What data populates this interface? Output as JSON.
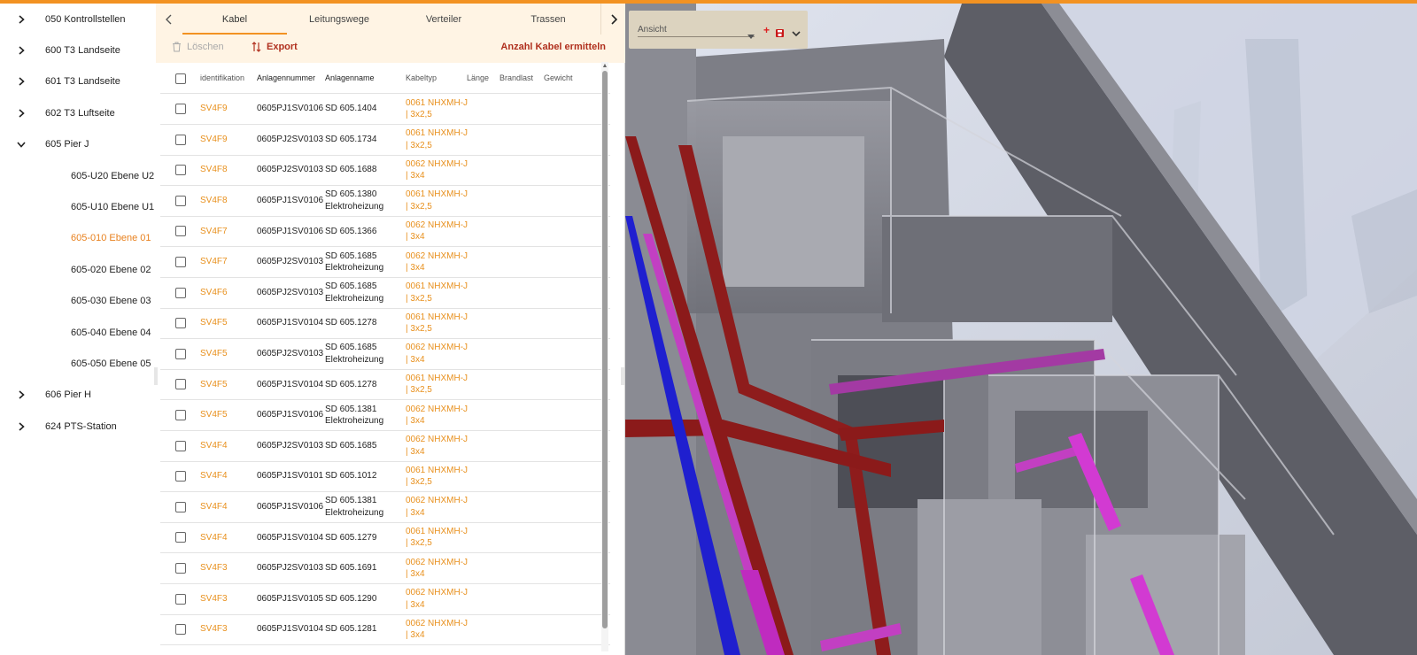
{
  "tree": [
    {
      "label": "050 Kontrollstellen",
      "level": 0,
      "expanded": false
    },
    {
      "label": "600 T3 Landseite",
      "level": 0,
      "expanded": false
    },
    {
      "label": "601 T3 Landseite",
      "level": 0,
      "expanded": false
    },
    {
      "label": "602 T3 Luftseite",
      "level": 0,
      "expanded": false
    },
    {
      "label": "605 Pier J",
      "level": 0,
      "expanded": true
    },
    {
      "label": "605-U20 Ebene U2",
      "level": 1
    },
    {
      "label": "605-U10 Ebene U1",
      "level": 1
    },
    {
      "label": "605-010 Ebene 01",
      "level": 1,
      "active": true
    },
    {
      "label": "605-020 Ebene 02",
      "level": 1
    },
    {
      "label": "605-030 Ebene 03",
      "level": 1
    },
    {
      "label": "605-040 Ebene 04",
      "level": 1
    },
    {
      "label": "605-050 Ebene 05",
      "level": 1
    },
    {
      "label": "606 Pier H",
      "level": 0,
      "expanded": false
    },
    {
      "label": "624 PTS-Station",
      "level": 0,
      "expanded": false
    }
  ],
  "tabs": [
    "Kabel",
    "Leitungswege",
    "Verteiler",
    "Trassen"
  ],
  "toolbar": {
    "delete_label": "Löschen",
    "export_label": "Export",
    "count_label": "Anzahl Kabel ermitteln"
  },
  "columns": [
    "identifikation",
    "Anlagennummer",
    "Anlagenname",
    "Kabeltyp",
    "Länge",
    "Brandlast",
    "Gewicht"
  ],
  "rows": [
    {
      "id": "SV4F9",
      "anlagennummer": "0605PJ1SV0106",
      "anlagenname": "SD 605.1404",
      "kabeltyp": "0061 NHXMH-J | 3x2,5"
    },
    {
      "id": "SV4F9",
      "anlagennummer": "0605PJ2SV0103",
      "anlagenname": "SD 605.1734",
      "kabeltyp": "0061 NHXMH-J | 3x2,5"
    },
    {
      "id": "SV4F8",
      "anlagennummer": "0605PJ2SV0103",
      "anlagenname": "SD 605.1688",
      "kabeltyp": "0062 NHXMH-J | 3x4"
    },
    {
      "id": "SV4F8",
      "anlagennummer": "0605PJ1SV0106",
      "anlagenname": "SD 605.1380 Elektroheizung",
      "kabeltyp": "0061 NHXMH-J | 3x2,5"
    },
    {
      "id": "SV4F7",
      "anlagennummer": "0605PJ1SV0106",
      "anlagenname": "SD 605.1366",
      "kabeltyp": "0062 NHXMH-J | 3x4"
    },
    {
      "id": "SV4F7",
      "anlagennummer": "0605PJ2SV0103",
      "anlagenname": "SD 605.1685 Elektroheizung",
      "kabeltyp": "0062 NHXMH-J | 3x4"
    },
    {
      "id": "SV4F6",
      "anlagennummer": "0605PJ2SV0103",
      "anlagenname": "SD 605.1685 Elektroheizung",
      "kabeltyp": "0061 NHXMH-J | 3x2,5"
    },
    {
      "id": "SV4F5",
      "anlagennummer": "0605PJ1SV0104",
      "anlagenname": "SD 605.1278",
      "kabeltyp": "0061 NHXMH-J | 3x2,5"
    },
    {
      "id": "SV4F5",
      "anlagennummer": "0605PJ2SV0103",
      "anlagenname": "SD 605.1685 Elektroheizung",
      "kabeltyp": "0062 NHXMH-J | 3x4"
    },
    {
      "id": "SV4F5",
      "anlagennummer": "0605PJ1SV0104",
      "anlagenname": "SD 605.1278",
      "kabeltyp": "0061 NHXMH-J | 3x2,5"
    },
    {
      "id": "SV4F5",
      "anlagennummer": "0605PJ1SV0106",
      "anlagenname": "SD 605.1381 Elektroheizung",
      "kabeltyp": "0062 NHXMH-J | 3x4"
    },
    {
      "id": "SV4F4",
      "anlagennummer": "0605PJ2SV0103",
      "anlagenname": "SD 605.1685",
      "kabeltyp": "0062 NHXMH-J | 3x4"
    },
    {
      "id": "SV4F4",
      "anlagennummer": "0605PJ1SV0101",
      "anlagenname": "SD 605.1012",
      "kabeltyp": "0061 NHXMH-J | 3x2,5"
    },
    {
      "id": "SV4F4",
      "anlagennummer": "0605PJ1SV0106",
      "anlagenname": "SD 605.1381 Elektroheizung",
      "kabeltyp": "0062 NHXMH-J | 3x4"
    },
    {
      "id": "SV4F4",
      "anlagennummer": "0605PJ1SV0104",
      "anlagenname": "SD 605.1279",
      "kabeltyp": "0061 NHXMH-J | 3x2,5"
    },
    {
      "id": "SV4F3",
      "anlagennummer": "0605PJ2SV0103",
      "anlagenname": "SD 605.1691",
      "kabeltyp": "0062 NHXMH-J | 3x4"
    },
    {
      "id": "SV4F3",
      "anlagennummer": "0605PJ1SV0105",
      "anlagenname": "SD 605.1290",
      "kabeltyp": "0062 NHXMH-J | 3x4"
    },
    {
      "id": "SV4F3",
      "anlagennummer": "0605PJ1SV0104",
      "anlagenname": "SD 605.1281",
      "kabeltyp": "0062 NHXMH-J | 3x4"
    }
  ],
  "viewer": {
    "view_placeholder": "Ansicht"
  },
  "colors": {
    "accent": "#f29222",
    "link_orange": "#e8901d",
    "action_red": "#b0301e",
    "tab_bg": "#fff4e4"
  },
  "icons": {
    "tree_collapsed": "chevron-right-icon",
    "tree_expanded": "chevron-down-icon",
    "delete": "trash-icon",
    "export": "sort-arrows-icon",
    "view_add": "plus-icon",
    "view_save": "save-icon"
  }
}
